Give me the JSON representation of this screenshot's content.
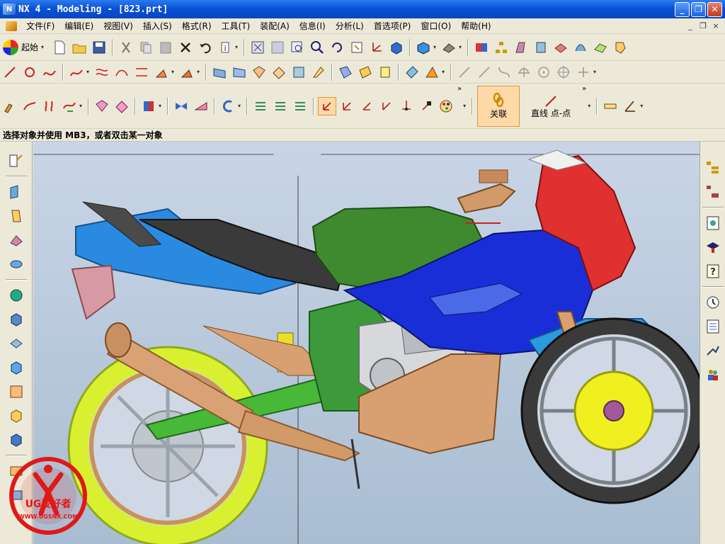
{
  "window": {
    "title": "NX 4 - Modeling - [823.prt]",
    "minimize": "_",
    "maximize": "❐",
    "close": "✕"
  },
  "menu": {
    "items": [
      "文件(F)",
      "编辑(E)",
      "视图(V)",
      "插入(S)",
      "格式(R)",
      "工具(T)",
      "装配(A)",
      "信息(I)",
      "分析(L)",
      "首选项(P)",
      "窗口(O)",
      "帮助(H)"
    ],
    "mdi": [
      "_",
      "❐",
      "×"
    ]
  },
  "toolbar": {
    "start_label": "起始",
    "assoc_label": "关联",
    "line_point_label": "直线 点-点",
    "chevron": "»"
  },
  "status": {
    "prompt": "选择对象并使用 MB3，或者双击某一对象"
  },
  "watermark": {
    "brand": "UG爱好者",
    "url": "WWW.UGSNX.COM"
  },
  "colors": {
    "titlebar": "#0a52d6",
    "viewport_top": "#c9d5e6",
    "viewport_bottom": "#a9bdd2",
    "active_button": "#ffd9a8"
  }
}
